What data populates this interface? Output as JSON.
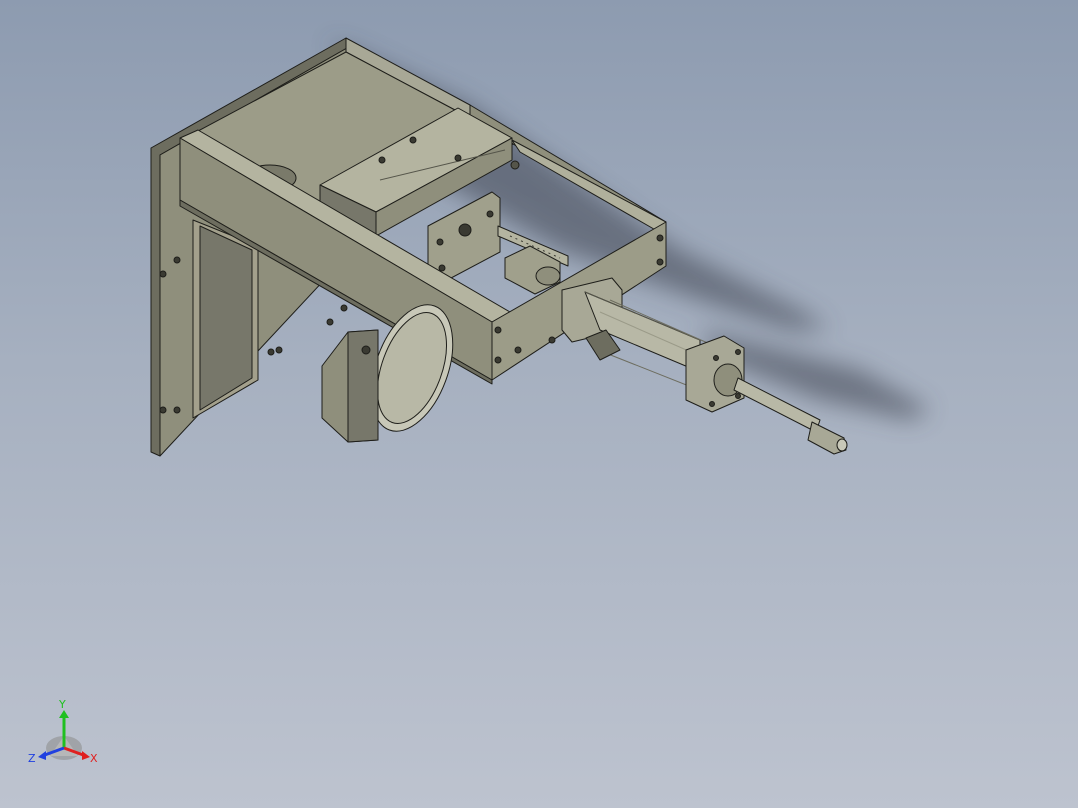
{
  "viewport": {
    "background_top": "#8d9bb0",
    "background_bottom": "#bdc3cf"
  },
  "model": {
    "part_color": "#8f8f7c",
    "part_dark": "#6d6d5f",
    "part_light": "#b4b4a0",
    "edge_color": "#1e1e1a",
    "shadow_color": "#3c4250"
  },
  "triad": {
    "x_label": "X",
    "y_label": "Y",
    "z_label": "Z",
    "x_color": "#e02020",
    "y_color": "#20c020",
    "z_color": "#2040e0"
  }
}
